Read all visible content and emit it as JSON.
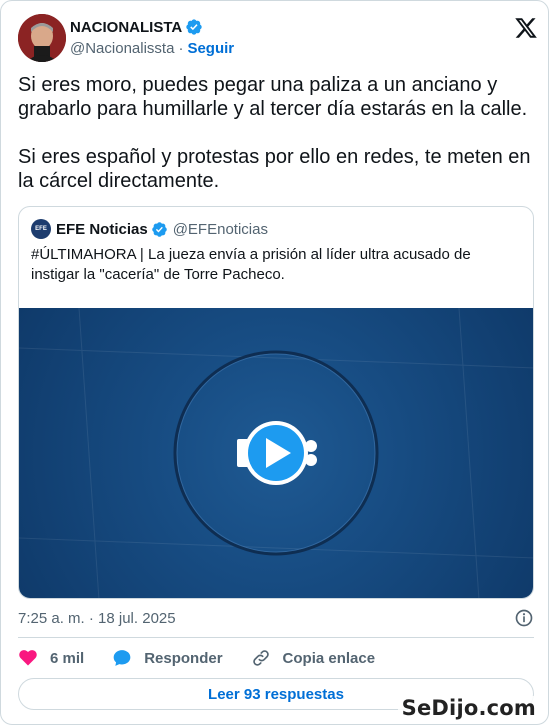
{
  "author": {
    "name": "NACIONALISTA",
    "handle": "@Nacionalissta",
    "separator": "·",
    "follow_label": "Seguir"
  },
  "tweet": {
    "text": "Si eres moro, puedes pegar una paliza a un anciano y grabarlo para humillarle y al tercer día estarás en la calle.\n\nSi eres español y protestas por ello en redes, te meten en la cárcel directamente.",
    "timestamp": "7:25 a. m. · 18 jul. 2025"
  },
  "quoted": {
    "avatar_text": "EFE",
    "name": "EFE Noticias",
    "handle": "@EFEnoticias",
    "text": "#ÚLTIMAHORA | La jueza envía a prisión al líder ultra acusado de instigar la \"cacería\" de Torre Pacheco."
  },
  "actions": {
    "likes": "6 mil",
    "reply_label": "Responder",
    "copy_label": "Copia enlace",
    "read_replies_label": "Leer 93 respuestas"
  },
  "watermark": "SeDijo.com",
  "colors": {
    "accent": "#1d9bf0",
    "link": "#006fd6",
    "like": "#f91880",
    "reply": "#1d9bf0",
    "muted": "#536471",
    "border": "#cfd9de",
    "media_bg": "#184e85"
  },
  "icons": [
    "verified-badge-icon",
    "x-logo-icon",
    "play-icon",
    "info-icon",
    "heart-icon",
    "reply-bubble-icon",
    "link-icon"
  ]
}
